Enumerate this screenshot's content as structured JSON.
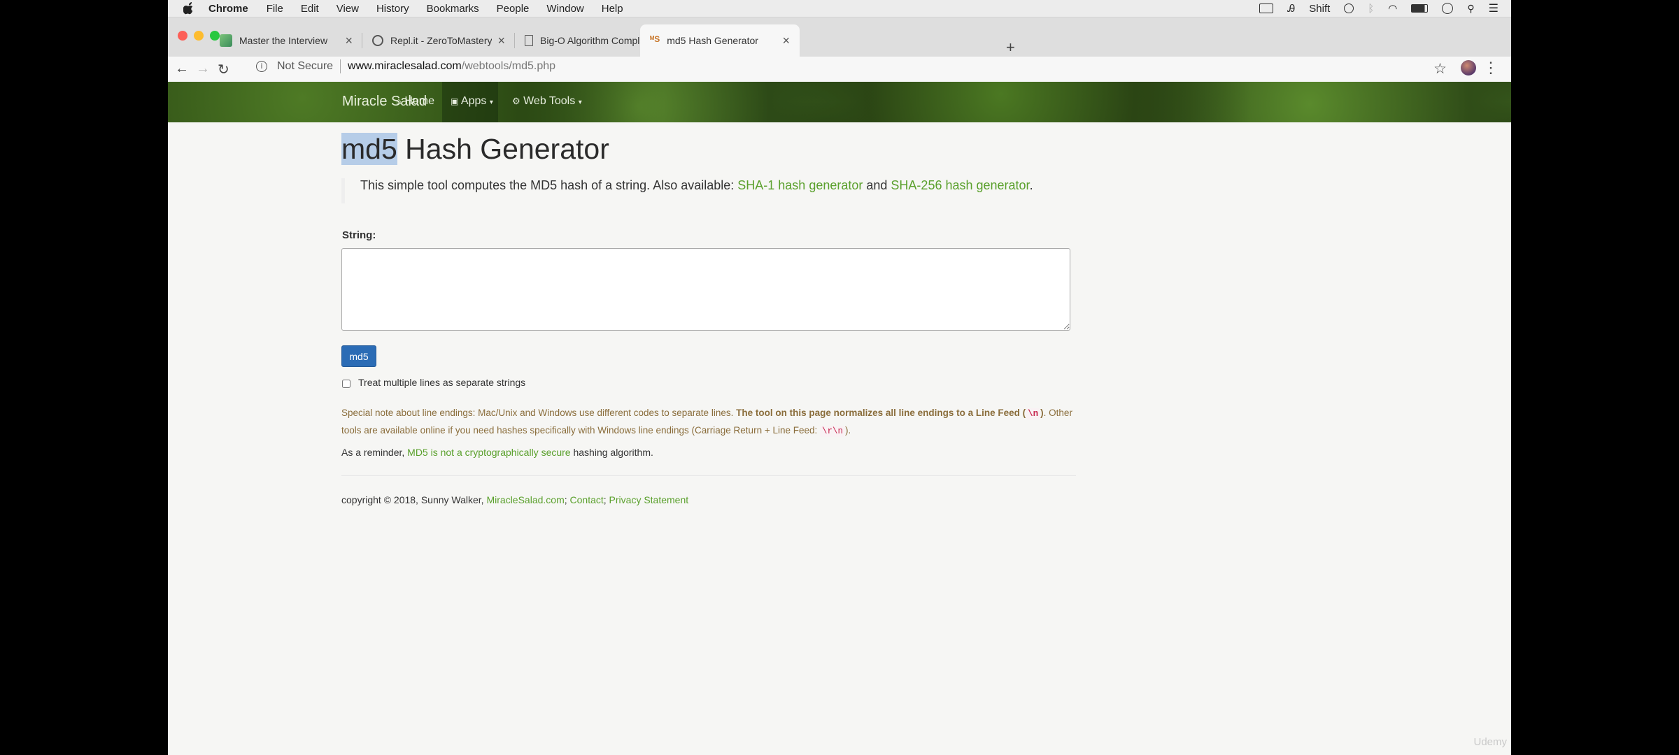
{
  "menubar": {
    "app": "Chrome",
    "items": [
      "File",
      "Edit",
      "View",
      "History",
      "Bookmarks",
      "People",
      "Window",
      "Help"
    ],
    "status_shift": "Shift",
    "icons": [
      "screen-record-icon",
      "text-input-icon",
      "clock-icon",
      "bluetooth-icon",
      "wifi-icon",
      "battery-icon",
      "info-icon",
      "spotlight-icon",
      "list-icon"
    ]
  },
  "tabs": [
    {
      "title": "Master the Interview",
      "favicon": "ztm-icon",
      "active": false
    },
    {
      "title": "Repl.it - ZeroToMastery",
      "favicon": "replit-icon",
      "active": false
    },
    {
      "title": "Big-O Algorithm Complexity Cheat Sheet",
      "favicon": "document-icon",
      "active": false
    },
    {
      "title": "md5 Hash Generator",
      "favicon": "ms-icon",
      "active": true
    }
  ],
  "toolbar": {
    "security_label": "Not Secure",
    "url_host": "www.miraclesalad.com",
    "url_path": "/webtools/md5.php"
  },
  "site_nav": {
    "brand": "Miracle Salad",
    "home": "Home",
    "apps": "Apps",
    "web_tools": "Web Tools"
  },
  "page": {
    "title_highlight": "md5",
    "title_rest": " Hash Generator",
    "lead_text": "This simple tool computes the MD5 hash of a string. Also available: ",
    "lead_link1": "SHA-1 hash generator",
    "lead_and": " and ",
    "lead_link2": "SHA-256 hash generator",
    "lead_end": ".",
    "string_label": "String:",
    "string_value": "",
    "button_label": "md5",
    "checkbox_label": "Treat multiple lines as separate strings",
    "checkbox_checked": false,
    "note_1": "Special note about line endings: Mac/Unix and Windows use different codes to separate lines. ",
    "note_bold": "The tool on this page normalizes all line endings to a Line Feed (",
    "note_code1": "\\n",
    "note_bold_end": ")",
    "note_2": ". Other tools are available online if you need hashes specifically with Windows line endings (Carriage Return + Line Feed: ",
    "note_code2": "\\r\\n",
    "note_3": ").",
    "reminder_pre": "As a reminder, ",
    "reminder_link": "MD5 is not a cryptographically secure",
    "reminder_post": " hashing algorithm."
  },
  "footer": {
    "copyright": "copyright © 2018, Sunny Walker, ",
    "link_site": "MiracleSalad.com",
    "sep1": "; ",
    "link_contact": "Contact",
    "sep2": "; ",
    "link_privacy": "Privacy Statement"
  },
  "watermark": "Udemy",
  "colors": {
    "link": "#5aa02c",
    "button": "#2b6cb5",
    "note": "#8a6d3b",
    "selection": "#b6cde8"
  }
}
